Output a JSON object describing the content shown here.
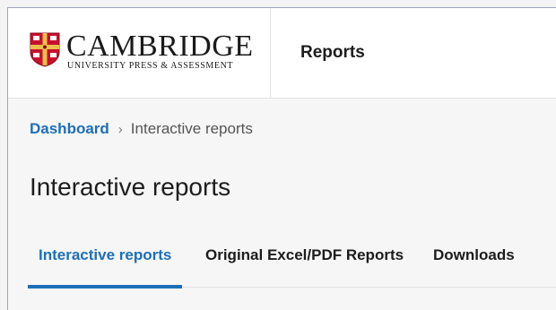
{
  "brand": {
    "name": "CAMBRIDGE",
    "subtitle": "UNIVERSITY PRESS & ASSESSMENT",
    "shield_colors": {
      "field": "#c8102e",
      "cross": "#e8c14a",
      "book": "#ffffff"
    }
  },
  "header": {
    "app_title": "Reports"
  },
  "breadcrumb": {
    "items": [
      {
        "label": "Dashboard"
      },
      {
        "label": "Interactive reports"
      }
    ],
    "separator": "›"
  },
  "page": {
    "title": "Interactive reports"
  },
  "tabs": [
    {
      "label": "Interactive reports",
      "active": true
    },
    {
      "label": "Original Excel/PDF Reports",
      "active": false
    },
    {
      "label": "Downloads",
      "active": false
    }
  ],
  "colors": {
    "accent": "#1d6fb8",
    "text": "#1c1c1c",
    "muted": "#555555"
  }
}
